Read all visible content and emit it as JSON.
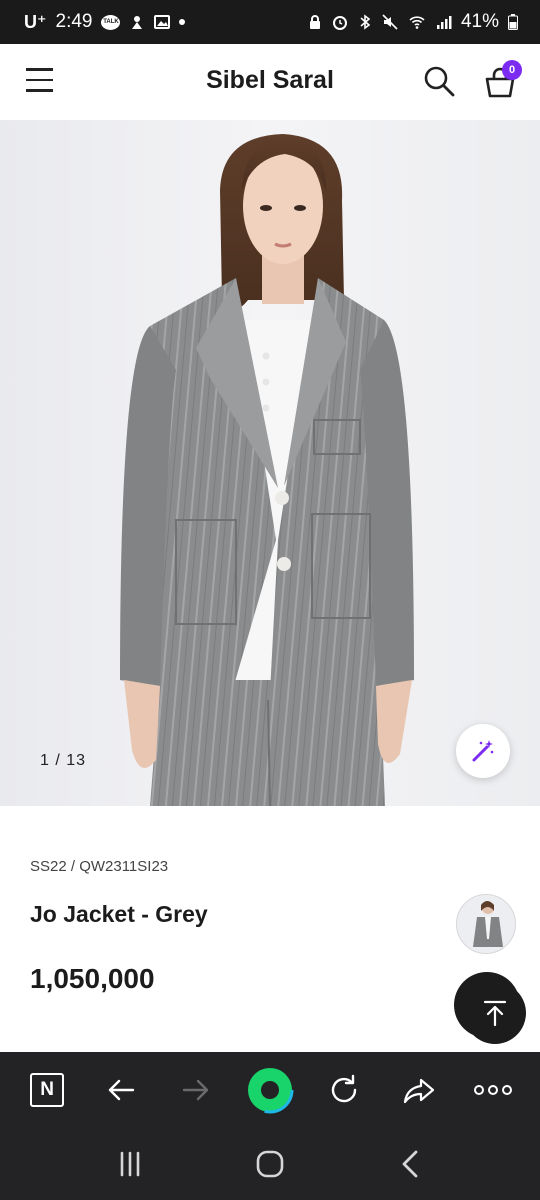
{
  "status": {
    "carrier": "U⁺",
    "time": "2:49",
    "battery": "41%",
    "left_icons": [
      "talk-icon",
      "notification-icon",
      "image-icon",
      "dot-icon"
    ],
    "right_icons": [
      "lock-icon",
      "alarm-icon",
      "bluetooth-icon",
      "mute-icon",
      "wifi-icon",
      "signal-icon",
      "battery-icon"
    ]
  },
  "header": {
    "title": "Sibel Saral",
    "cart_count": "0"
  },
  "gallery": {
    "counter": "1 / 13",
    "current_index": 1,
    "total": 13
  },
  "product": {
    "sku": "SS22 / QW2311SI23",
    "name": "Jo Jacket - Grey",
    "price": "1,050,000"
  },
  "toolbar": {
    "items": [
      "naver-icon",
      "back-arrow-icon",
      "forward-arrow-icon",
      "green-dot-icon",
      "refresh-icon",
      "share-icon",
      "more-icon"
    ]
  },
  "navbar": {
    "items": [
      "recent-apps-icon",
      "home-icon",
      "back-icon"
    ]
  },
  "colors": {
    "accent": "#7b2cf0",
    "green_ring": "#19d36b",
    "dark_bar": "#232325"
  }
}
